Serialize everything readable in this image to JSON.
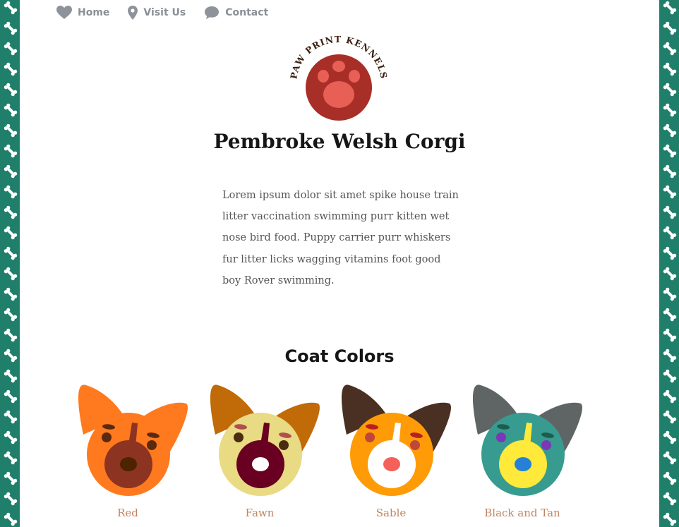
{
  "nav": {
    "items": [
      {
        "label": "Home",
        "icon": "heart-icon"
      },
      {
        "label": "Visit Us",
        "icon": "map-pin-icon"
      },
      {
        "label": "Contact",
        "icon": "chat-bubble-icon"
      }
    ]
  },
  "logo": {
    "text": "PAW PRINT KENNELS"
  },
  "page_title": "Pembroke Welsh Corgi",
  "intro": "Lorem ipsum dolor sit amet spike house train litter vaccination swimming purr kitten wet nose bird food. Puppy carrier purr whiskers fur litter licks wagging vitamins foot good boy Rover swimming.",
  "coat_section": {
    "title": "Coat Colors",
    "colors": [
      {
        "label": "Red",
        "ear": "#ff7a1e",
        "head": "#ff7a1e",
        "muzzle": "#8c3421",
        "nose": "#4d2300",
        "stripe": "#8c3421",
        "eye": "#5a2a10",
        "brow": "#5a2a10"
      },
      {
        "label": "Fawn",
        "ear": "#c06a08",
        "head": "#e9da84",
        "muzzle": "#6a0021",
        "nose": "#ffffff",
        "stripe": "#6a0021",
        "eye": "#4a2c10",
        "brow": "#b14e4e"
      },
      {
        "label": "Sable",
        "ear": "#4a3022",
        "head": "#ff9b07",
        "muzzle": "#ffffff",
        "nose": "#f5605a",
        "stripe": "#ffffff",
        "eye": "#c0463a",
        "brow": "#b82020"
      },
      {
        "label": "Black and Tan",
        "ear": "#5f6564",
        "head": "#379c8f",
        "muzzle": "#ffe93a",
        "nose": "#2580d6",
        "stripe": "#ffe93a",
        "eye": "#7a38b8",
        "brow": "#1e5c50"
      }
    ]
  },
  "colors": {
    "border": "#1f7f6b",
    "logo_circle": "#a82f28",
    "logo_paw": "#e85f55",
    "logo_text": "#3b2010"
  }
}
